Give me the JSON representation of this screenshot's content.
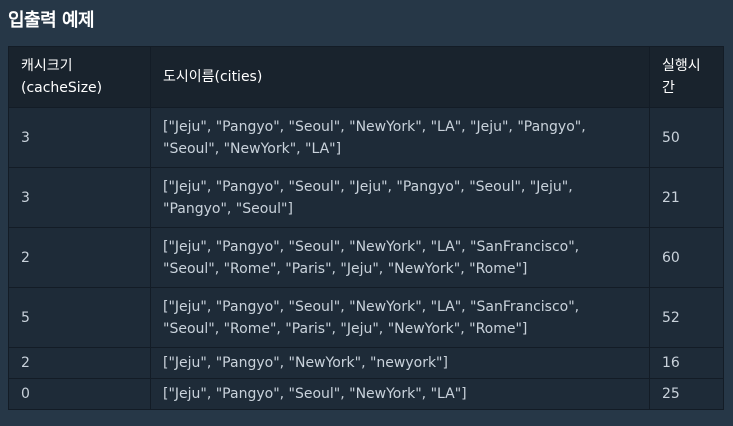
{
  "heading": "입출력 예제",
  "table": {
    "headers": {
      "cache_size": "캐시크기(cacheSize)",
      "cities": "도시이름(cities)",
      "run_time": "실행시간"
    },
    "rows": [
      {
        "cache_size": "3",
        "cities": "[\"Jeju\", \"Pangyo\", \"Seoul\", \"NewYork\", \"LA\", \"Jeju\", \"Pangyo\", \"Seoul\", \"NewYork\", \"LA\"]",
        "run_time": "50"
      },
      {
        "cache_size": "3",
        "cities": "[\"Jeju\", \"Pangyo\", \"Seoul\", \"Jeju\", \"Pangyo\", \"Seoul\", \"Jeju\", \"Pangyo\", \"Seoul\"]",
        "run_time": "21"
      },
      {
        "cache_size": "2",
        "cities": "[\"Jeju\", \"Pangyo\", \"Seoul\", \"NewYork\", \"LA\", \"SanFrancisco\", \"Seoul\", \"Rome\", \"Paris\", \"Jeju\", \"NewYork\", \"Rome\"]",
        "run_time": "60"
      },
      {
        "cache_size": "5",
        "cities": "[\"Jeju\", \"Pangyo\", \"Seoul\", \"NewYork\", \"LA\", \"SanFrancisco\", \"Seoul\", \"Rome\", \"Paris\", \"Jeju\", \"NewYork\", \"Rome\"]",
        "run_time": "52"
      },
      {
        "cache_size": "2",
        "cities": "[\"Jeju\", \"Pangyo\", \"NewYork\", \"newyork\"]",
        "run_time": "16"
      },
      {
        "cache_size": "0",
        "cities": "[\"Jeju\", \"Pangyo\", \"Seoul\", \"NewYork\", \"LA\"]",
        "run_time": "25"
      }
    ]
  }
}
